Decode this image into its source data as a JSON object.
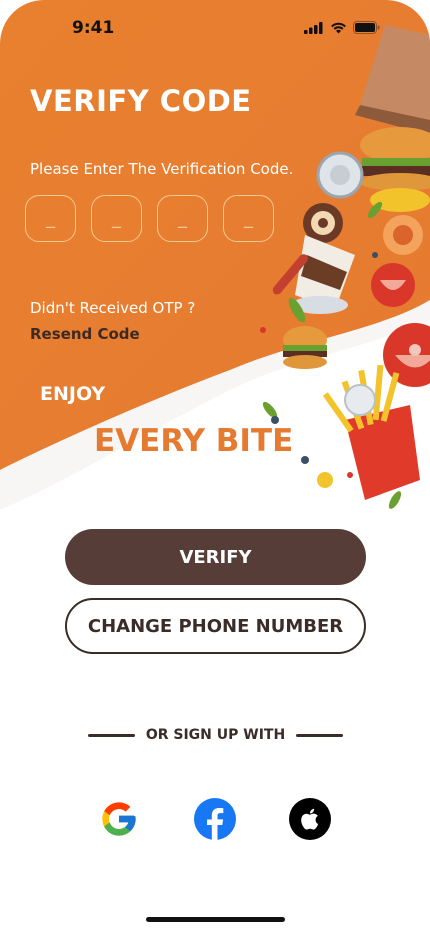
{
  "status_bar": {
    "time": "9:41"
  },
  "header": {
    "title": "VERIFY CODE",
    "subtitle": "Please Enter The Verification Code."
  },
  "otp": {
    "placeholders": [
      "_",
      "_",
      "_",
      "_"
    ]
  },
  "resend": {
    "question": "Didn't Received OTP ?",
    "link_label": "Resend Code"
  },
  "tagline": {
    "line1": "ENJOY",
    "line2": "EVERY BITE"
  },
  "buttons": {
    "verify_label": "VERIFY",
    "change_phone_label": "CHANGE PHONE NUMBER"
  },
  "social": {
    "divider_label": "OR SIGN UP WITH",
    "providers": [
      "google-icon",
      "facebook-icon",
      "apple-icon"
    ]
  },
  "colors": {
    "brand_orange": "#e57a31",
    "button_brown": "#573d38",
    "text_dark": "#3a2c28"
  }
}
